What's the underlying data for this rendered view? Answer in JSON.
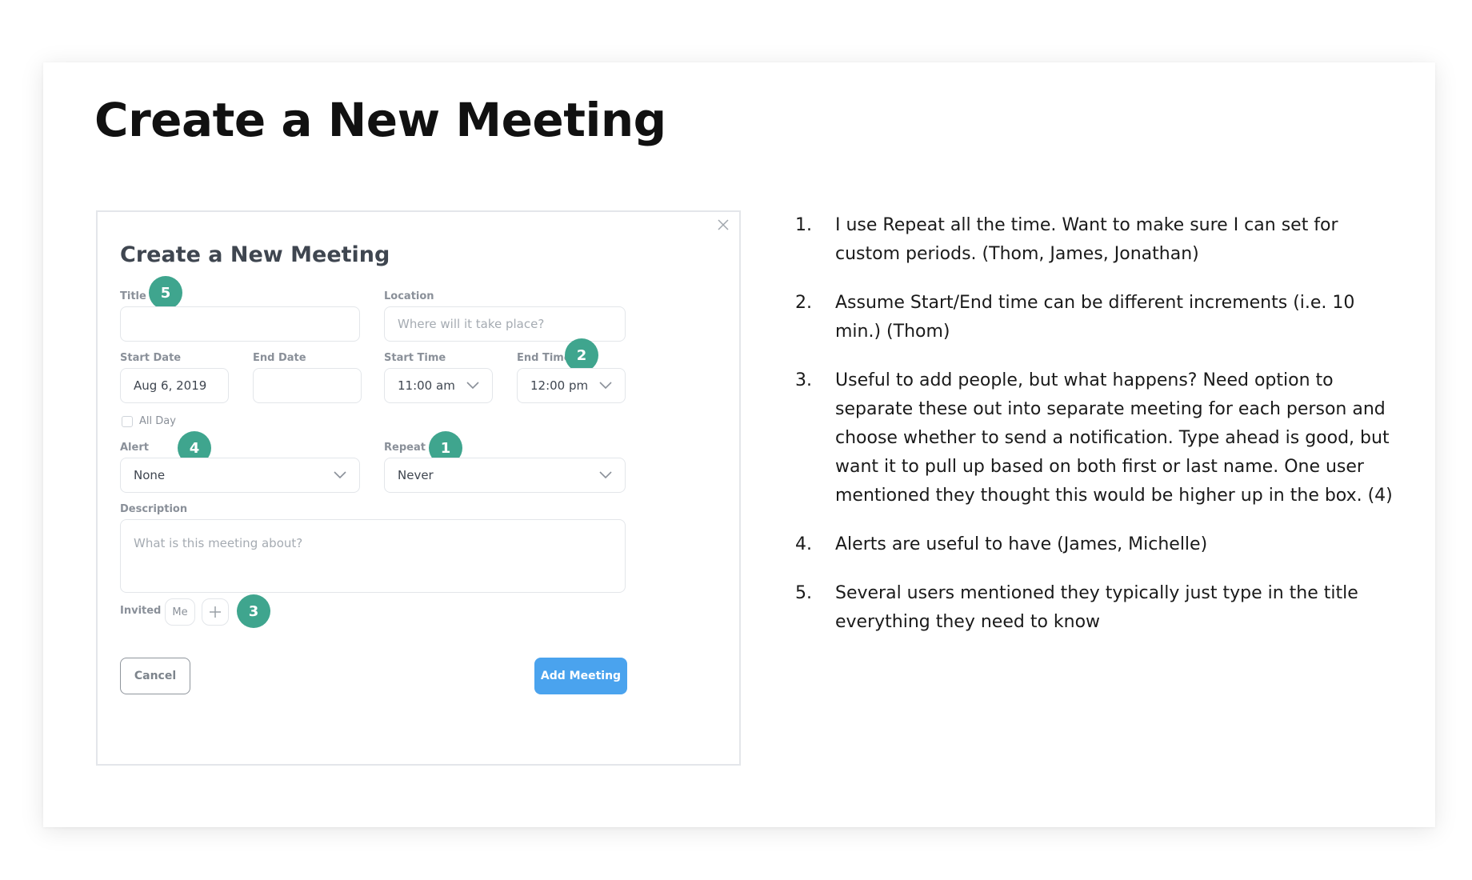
{
  "slide": {
    "title": "Create a New Meeting"
  },
  "dialog": {
    "title": "Create a New Meeting",
    "close_icon": "close-icon",
    "fields": {
      "title": {
        "label": "Title",
        "value": "",
        "placeholder": ""
      },
      "location": {
        "label": "Location",
        "value": "",
        "placeholder": "Where will it take place?"
      },
      "start_date": {
        "label": "Start Date",
        "value": "Aug 6, 2019"
      },
      "end_date": {
        "label": "End Date",
        "value": ""
      },
      "start_time": {
        "label": "Start Time",
        "value": "11:00 am"
      },
      "end_time": {
        "label": "End Time",
        "value": "12:00 pm"
      },
      "all_day": {
        "label": "All Day",
        "checked": false
      },
      "alert": {
        "label": "Alert",
        "value": "None"
      },
      "repeat": {
        "label": "Repeat",
        "value": "Never"
      },
      "description": {
        "label": "Description",
        "value": "",
        "placeholder": "What is this meeting about?"
      }
    },
    "invited": {
      "label": "Invited",
      "people": [
        "Me"
      ],
      "add_icon": "plus-icon"
    },
    "buttons": {
      "cancel": "Cancel",
      "add": "Add Meeting"
    },
    "markers": [
      "1",
      "2",
      "3",
      "4",
      "5"
    ],
    "colors": {
      "marker": "#3fa58e",
      "primary_button": "#4aa3ee",
      "dialog_title": "#3f4650",
      "label": "#8a9099"
    }
  },
  "notes": [
    {
      "num": "1.",
      "text": "I use Repeat all the time. Want to make sure I can set for custom periods. (Thom, James, Jonathan)"
    },
    {
      "num": "2.",
      "text": "Assume Start/End time can be different increments (i.e. 10 min.) (Thom)"
    },
    {
      "num": "3.",
      "text": "Useful to add people, but what happens?  Need option to separate these out into separate meeting for each person and choose whether to send a notification. Type ahead is good, but want it to pull up based on both first or last name. One user mentioned they thought this would be higher up in the box. (4)"
    },
    {
      "num": "4.",
      "text": "Alerts are useful to have (James, Michelle)"
    },
    {
      "num": "5.",
      "text": "Several users mentioned they typically just type in the title everything they need to know"
    }
  ]
}
